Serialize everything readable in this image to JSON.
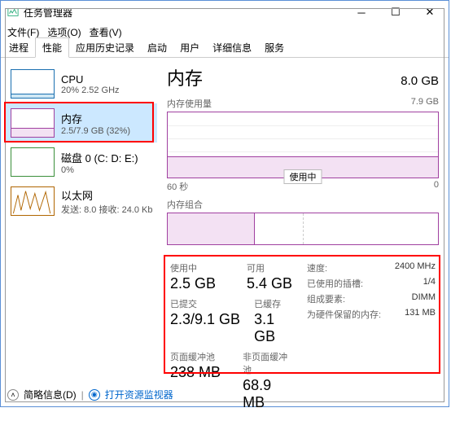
{
  "window": {
    "title": "任务管理器"
  },
  "menu": {
    "file": "文件(F)",
    "options": "选项(O)",
    "view": "查看(V)"
  },
  "tabs": [
    "进程",
    "性能",
    "应用历史记录",
    "启动",
    "用户",
    "详细信息",
    "服务"
  ],
  "sidebar": {
    "cpu": {
      "title": "CPU",
      "sub": "20% 2.52 GHz"
    },
    "mem": {
      "title": "内存",
      "sub": "2.5/7.9 GB (32%)"
    },
    "disk": {
      "title": "磁盘 0 (C: D: E:)",
      "sub": "0%"
    },
    "net": {
      "title": "以太网",
      "sub": "发送: 8.0 接收: 24.0 Kb"
    }
  },
  "main": {
    "title": "内存",
    "total": "8.0 GB",
    "usage_label": "内存使用量",
    "usage_max": "7.9 GB",
    "axis_left": "60 秒",
    "axis_right": "0",
    "badge": "使用中",
    "composition_label": "内存组合"
  },
  "stats": {
    "in_use": {
      "label": "使用中",
      "value": "2.5 GB"
    },
    "available": {
      "label": "可用",
      "value": "5.4 GB"
    },
    "committed": {
      "label": "已提交",
      "value": "2.3/9.1 GB"
    },
    "cached": {
      "label": "已缓存",
      "value": "3.1 GB"
    },
    "paged": {
      "label": "页面缓冲池",
      "value": "238 MB"
    },
    "nonpaged": {
      "label": "非页面缓冲池",
      "value": "68.9 MB"
    }
  },
  "meta": {
    "speed": {
      "k": "速度:",
      "v": "2400 MHz"
    },
    "slots": {
      "k": "已使用的插槽:",
      "v": "1/4"
    },
    "form": {
      "k": "组成要素:",
      "v": "DIMM"
    },
    "reserved": {
      "k": "为硬件保留的内存:",
      "v": "131 MB"
    }
  },
  "footer": {
    "brief": "简略信息(D)",
    "link": "打开资源监视器"
  },
  "chart_data": {
    "type": "line",
    "title": "内存使用量",
    "ylim": [
      0,
      7.9
    ],
    "ylabel": "GB",
    "xlabel": "秒",
    "xrange": [
      60,
      0
    ],
    "series": [
      {
        "name": "内存",
        "approx_value": 2.5
      }
    ]
  }
}
